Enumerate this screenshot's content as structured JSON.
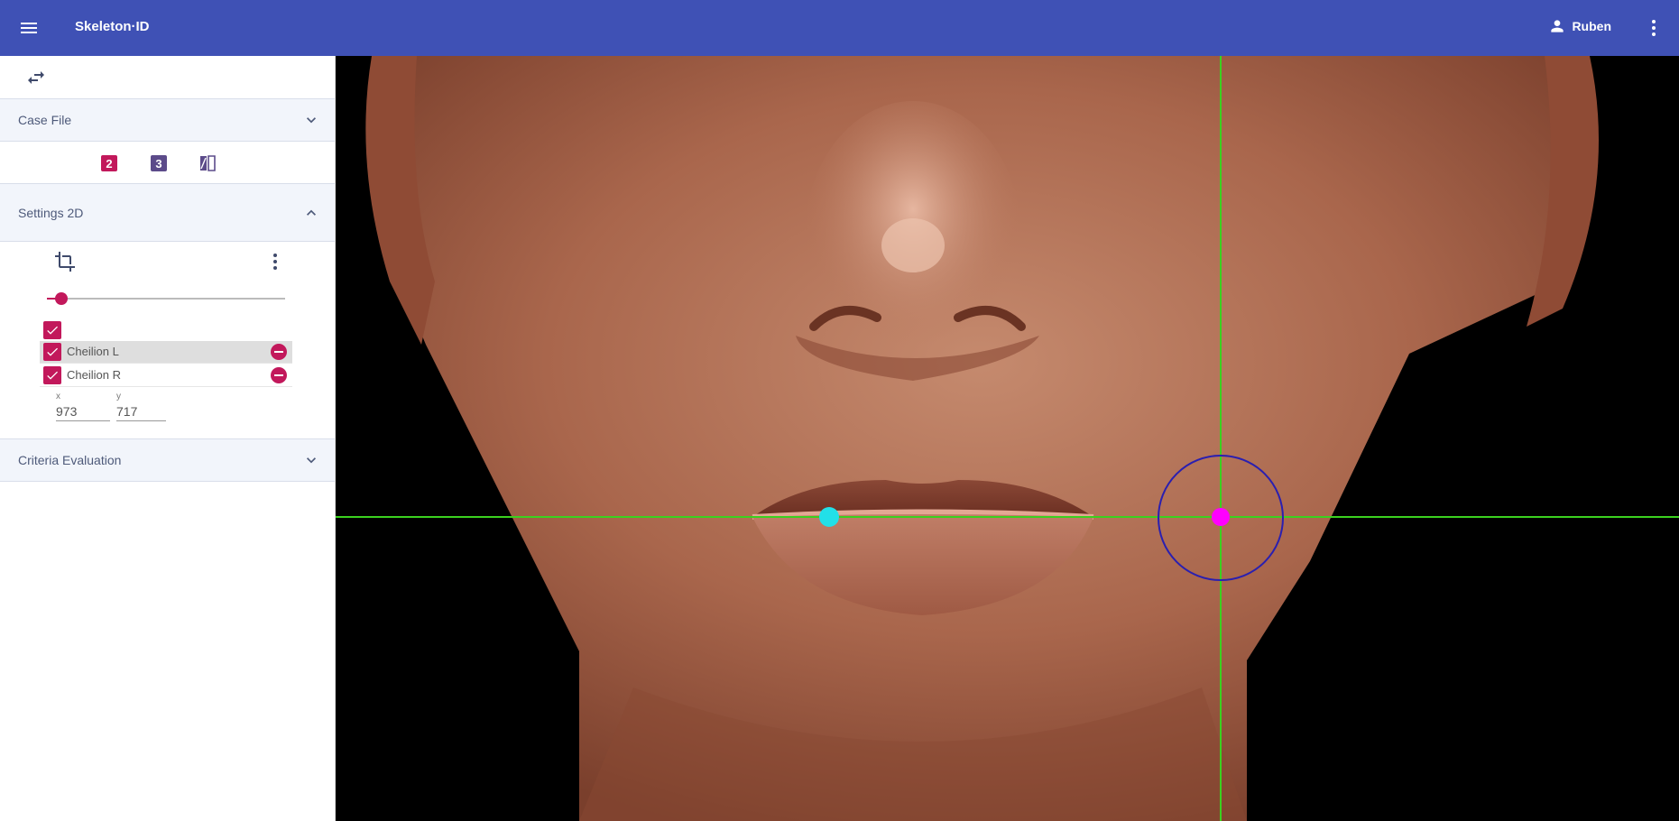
{
  "app": {
    "title": "Skeleton·ID"
  },
  "topbar": {
    "user_name": "Ruben"
  },
  "icons": {
    "menu": "menu-icon",
    "user": "person-icon",
    "more": "more-vert-icon",
    "swap": "swap-horiz-icon",
    "crop": "crop-icon"
  },
  "panels": {
    "case_file": {
      "label": "Case File",
      "expanded": false
    },
    "settings_2d": {
      "label": "Settings 2D",
      "expanded": true
    },
    "criteria": {
      "label": "Criteria Evaluation",
      "expanded": false
    }
  },
  "modes": [
    {
      "name": "2d-mode",
      "glyph": "2",
      "color": "#c2185b"
    },
    {
      "name": "3d-mode",
      "glyph": "3",
      "color": "#5c4b8a"
    },
    {
      "name": "compare-mode",
      "glyph": "compare",
      "color": "#5c4b8a"
    }
  ],
  "settings": {
    "slider_level": 0.06,
    "select_all_checked": true,
    "landmarks": [
      {
        "label": "Cheilion L",
        "checked": true,
        "selected": true
      },
      {
        "label": "Cheilion R",
        "checked": true,
        "selected": false
      }
    ],
    "coord_x_label": "x",
    "coord_y_label": "y",
    "coord_x_value": "973",
    "coord_y_value": "717"
  },
  "colors": {
    "header": "#3f51b5",
    "accent": "#c2185b",
    "crosshair": "#3bd11f",
    "landmark_left": "#22e0e8",
    "landmark_right": "#ff00ff",
    "radius_circle": "#2a1fb0"
  }
}
